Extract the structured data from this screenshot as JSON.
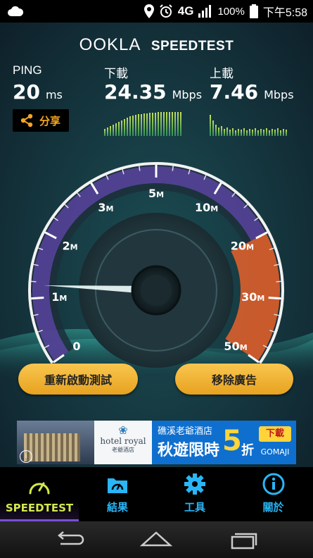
{
  "status_bar": {
    "network": "4G",
    "battery": "100%",
    "time": "下午5:58",
    "icons": [
      "cloud-icon",
      "location-icon",
      "alarm-icon",
      "signal-icon",
      "battery-icon"
    ]
  },
  "brand": {
    "ookla": "OOKLA",
    "speedtest": "SPEEDTEST"
  },
  "stats": {
    "ping": {
      "label": "PING",
      "value": "20",
      "unit": "ms"
    },
    "download": {
      "label": "下載",
      "value": "24.35",
      "unit": "Mbps"
    },
    "upload": {
      "label": "上載",
      "value": "7.46",
      "unit": "Mbps"
    }
  },
  "share": {
    "label": "分享",
    "icon": "share-icon",
    "color": "#f5a623"
  },
  "gauge": {
    "ticks": [
      {
        "label": "0",
        "unit": ""
      },
      {
        "label": "1",
        "unit": "M"
      },
      {
        "label": "2",
        "unit": "M"
      },
      {
        "label": "3",
        "unit": "M"
      },
      {
        "label": "5",
        "unit": "M"
      },
      {
        "label": "10",
        "unit": "M"
      },
      {
        "label": "20",
        "unit": "M"
      },
      {
        "label": "30",
        "unit": "M"
      },
      {
        "label": "50",
        "unit": "M"
      }
    ],
    "needle_value_mbps": 1.2
  },
  "buttons": {
    "restart": "重新啟動測試",
    "remove_ads": "移除廣告"
  },
  "ad": {
    "brand_logo_text": "hotel royal",
    "brand_sub": "老爺酒店",
    "headline_top": "礁溪老爺酒店",
    "headline": "秋遊限時",
    "discount_number": "5",
    "discount_unit": "折",
    "cta": "下載",
    "partner": "GOMAJI"
  },
  "nav": {
    "items": [
      {
        "label": "SPEEDTEST",
        "icon": "gauge-icon",
        "active": true
      },
      {
        "label": "結果",
        "icon": "results-icon",
        "active": false
      },
      {
        "label": "工具",
        "icon": "gear-icon",
        "active": false
      },
      {
        "label": "關於",
        "icon": "info-icon",
        "active": false
      }
    ]
  },
  "system_nav": {
    "icons": [
      "back-icon",
      "home-icon",
      "recents-icon"
    ]
  },
  "colors": {
    "accent": "#29b6f6",
    "active": "#d4e84a",
    "orange": "#f5a623",
    "gauge_purple": "#7a4fd6",
    "gauge_red": "#e8622a"
  }
}
